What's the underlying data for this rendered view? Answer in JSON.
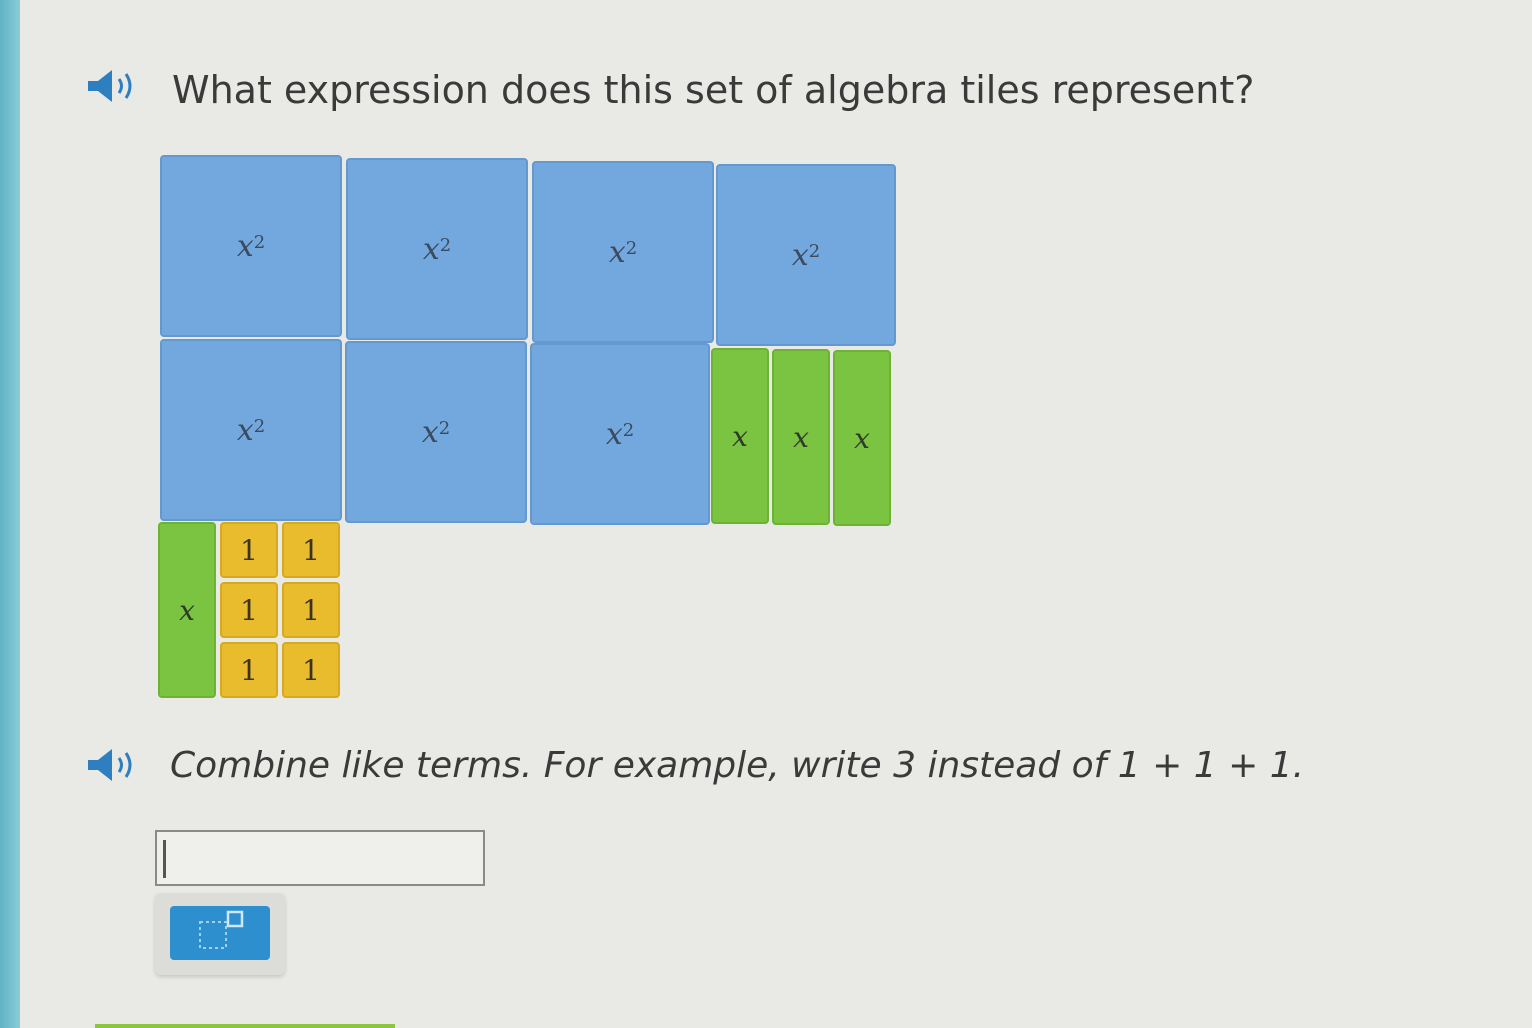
{
  "question": {
    "text": "What expression does this set of algebra tiles represent?"
  },
  "instruction": {
    "text": "Combine like terms. For example, write 3 instead of 1 + 1 + 1."
  },
  "tiles": {
    "x2_label": "x",
    "x2_exponent": "2",
    "x_label": "x",
    "one_label": "1"
  },
  "answer": {
    "value": "",
    "placeholder": ""
  },
  "icons": {
    "speaker": "speaker-icon",
    "math_keypad": "math-keypad-icon"
  },
  "colors": {
    "x2_tile": "#72a8dd",
    "x_tile": "#7bc442",
    "one_tile": "#e9bc2e",
    "speaker": "#2e7fc0",
    "keypad_button": "#2e8fcf"
  }
}
